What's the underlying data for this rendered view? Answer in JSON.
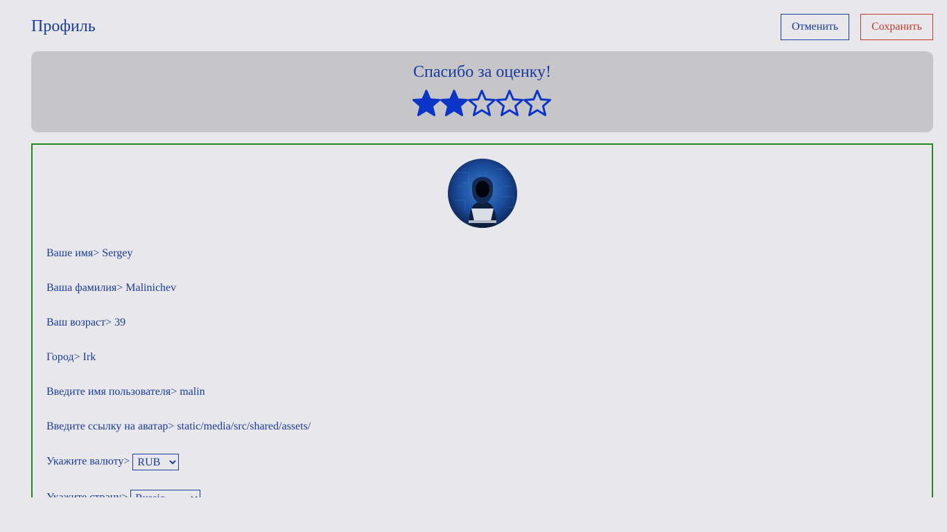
{
  "header": {
    "title": "Профиль",
    "cancel_label": "Отменить",
    "save_label": "Сохранить",
    "cancel_color": "#1a3aa0",
    "save_color": "#c0392b"
  },
  "rating": {
    "title": "Спасибо за оценку!",
    "value": 2,
    "max": 5,
    "star_icon": "star-icon",
    "color": "#0a35c8"
  },
  "profile": {
    "avatar_icon": "hooded-hacker-avatar",
    "fields": [
      {
        "label": "Ваше имя>",
        "value": "Sergey"
      },
      {
        "label": "Ваша фамилия>",
        "value": "Malinichev"
      },
      {
        "label": "Ваш возраст>",
        "value": "39"
      },
      {
        "label": "Город>",
        "value": "Irk"
      },
      {
        "label": "Введите имя пользователя>",
        "value": "malin"
      },
      {
        "label": "Введите ссылку на аватар>",
        "value": "static/media/src/shared/assets/"
      }
    ],
    "currency": {
      "label": "Укажите валюту>",
      "selected": "RUB"
    },
    "country": {
      "label": "Укажите страну>",
      "selected": "Russia"
    },
    "border_color": "#1f8a1f"
  }
}
